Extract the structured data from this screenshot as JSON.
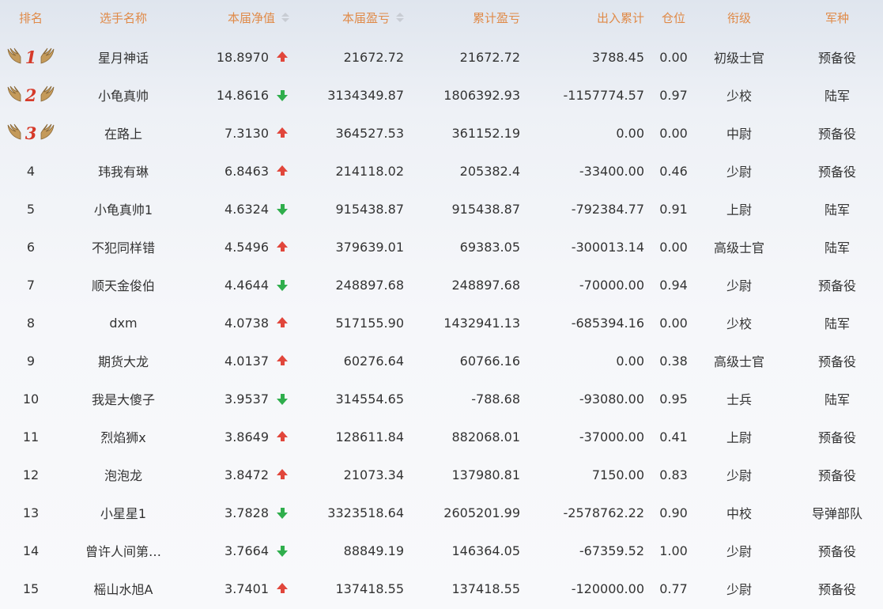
{
  "headers": {
    "rank": "排名",
    "name": "选手名称",
    "net": "本届净值",
    "pl": "本届盈亏",
    "cum": "累计盈亏",
    "io": "出入累计",
    "pos": "仓位",
    "grade": "衔级",
    "army": "军种"
  },
  "colors": {
    "header_text": "#e08a48",
    "up": "#e1463b",
    "down": "#2fae4c",
    "medal_number": "#d63a2a"
  },
  "rows": [
    {
      "rank": "1",
      "name": "星月神话",
      "net": "18.8970",
      "trend": "up",
      "pl": "21672.72",
      "cum": "21672.72",
      "io": "3788.45",
      "pos": "0.00",
      "grade": "初级士官",
      "army": "预备役"
    },
    {
      "rank": "2",
      "name": "小龟真帅",
      "net": "14.8616",
      "trend": "down",
      "pl": "3134349.87",
      "cum": "1806392.93",
      "io": "-1157774.57",
      "pos": "0.97",
      "grade": "少校",
      "army": "陆军"
    },
    {
      "rank": "3",
      "name": "在路上",
      "net": "7.3130",
      "trend": "up",
      "pl": "364527.53",
      "cum": "361152.19",
      "io": "0.00",
      "pos": "0.00",
      "grade": "中尉",
      "army": "预备役"
    },
    {
      "rank": "4",
      "name": "玮我有琳",
      "net": "6.8463",
      "trend": "up",
      "pl": "214118.02",
      "cum": "205382.4",
      "io": "-33400.00",
      "pos": "0.46",
      "grade": "少尉",
      "army": "预备役"
    },
    {
      "rank": "5",
      "name": "小龟真帅1",
      "net": "4.6324",
      "trend": "down",
      "pl": "915438.87",
      "cum": "915438.87",
      "io": "-792384.77",
      "pos": "0.91",
      "grade": "上尉",
      "army": "陆军"
    },
    {
      "rank": "6",
      "name": "不犯同样错",
      "net": "4.5496",
      "trend": "up",
      "pl": "379639.01",
      "cum": "69383.05",
      "io": "-300013.14",
      "pos": "0.00",
      "grade": "高级士官",
      "army": "陆军"
    },
    {
      "rank": "7",
      "name": "顺天金俊伯",
      "net": "4.4644",
      "trend": "down",
      "pl": "248897.68",
      "cum": "248897.68",
      "io": "-70000.00",
      "pos": "0.94",
      "grade": "少尉",
      "army": "预备役"
    },
    {
      "rank": "8",
      "name": "dxm",
      "net": "4.0738",
      "trend": "up",
      "pl": "517155.90",
      "cum": "1432941.13",
      "io": "-685394.16",
      "pos": "0.00",
      "grade": "少校",
      "army": "陆军"
    },
    {
      "rank": "9",
      "name": "期货大龙",
      "net": "4.0137",
      "trend": "up",
      "pl": "60276.64",
      "cum": "60766.16",
      "io": "0.00",
      "pos": "0.38",
      "grade": "高级士官",
      "army": "预备役"
    },
    {
      "rank": "10",
      "name": "我是大傻子",
      "net": "3.9537",
      "trend": "down",
      "pl": "314554.65",
      "cum": "-788.68",
      "io": "-93080.00",
      "pos": "0.95",
      "grade": "士兵",
      "army": "陆军"
    },
    {
      "rank": "11",
      "name": "烈焰狮x",
      "net": "3.8649",
      "trend": "up",
      "pl": "128611.84",
      "cum": "882068.01",
      "io": "-37000.00",
      "pos": "0.41",
      "grade": "上尉",
      "army": "预备役"
    },
    {
      "rank": "12",
      "name": "泡泡龙",
      "net": "3.8472",
      "trend": "up",
      "pl": "21073.34",
      "cum": "137980.81",
      "io": "7150.00",
      "pos": "0.83",
      "grade": "少尉",
      "army": "预备役"
    },
    {
      "rank": "13",
      "name": "小星星1",
      "net": "3.7828",
      "trend": "down",
      "pl": "3323518.64",
      "cum": "2605201.99",
      "io": "-2578762.22",
      "pos": "0.90",
      "grade": "中校",
      "army": "导弹部队"
    },
    {
      "rank": "14",
      "name": "曾许人间第…",
      "net": "3.7664",
      "trend": "down",
      "pl": "88849.19",
      "cum": "146364.05",
      "io": "-67359.52",
      "pos": "1.00",
      "grade": "少尉",
      "army": "预备役"
    },
    {
      "rank": "15",
      "name": "榣山水旭A",
      "net": "3.7401",
      "trend": "up",
      "pl": "137418.55",
      "cum": "137418.55",
      "io": "-120000.00",
      "pos": "0.77",
      "grade": "少尉",
      "army": "预备役"
    }
  ]
}
